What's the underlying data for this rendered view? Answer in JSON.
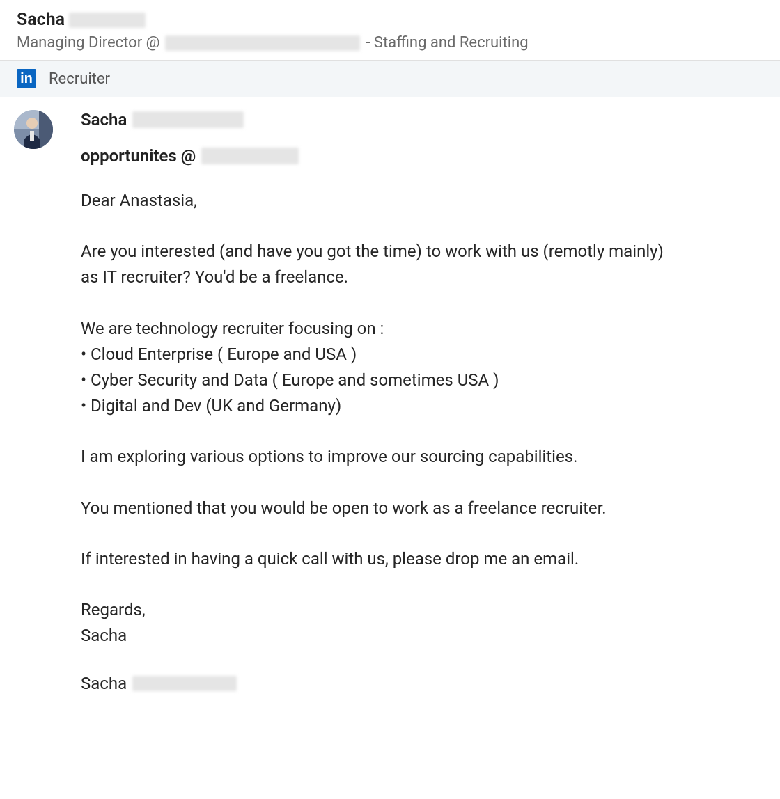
{
  "header": {
    "first_name": "Sacha",
    "title_prefix": "Managing Director @",
    "title_suffix": "- Staffing and Recruiting"
  },
  "banner": {
    "badge_text": "in",
    "label": "Recruiter"
  },
  "message": {
    "sender_first_name": "Sacha",
    "subject_prefix": "opportunites @",
    "greeting": "Dear Anastasia,",
    "para1": "Are you interested (and have you got the time) to work with us (remotly mainly) as IT recruiter? You'd be a freelance.",
    "para2_intro": "We are technology recruiter focusing on :",
    "bullet1": "• Cloud Enterprise ( Europe and USA )",
    "bullet2": "• Cyber Security and Data ( Europe and sometimes USA )",
    "bullet3": "• Digital and Dev (UK and Germany)",
    "para3": "I am exploring various options to improve our sourcing capabilities.",
    "para4": "You mentioned that you would be open to work as a freelance recruiter.",
    "para5": "If interested in having a quick call with us, please drop me an email.",
    "regards": "Regards,",
    "sign_name": "Sacha",
    "footer_sig_first": "Sacha"
  }
}
